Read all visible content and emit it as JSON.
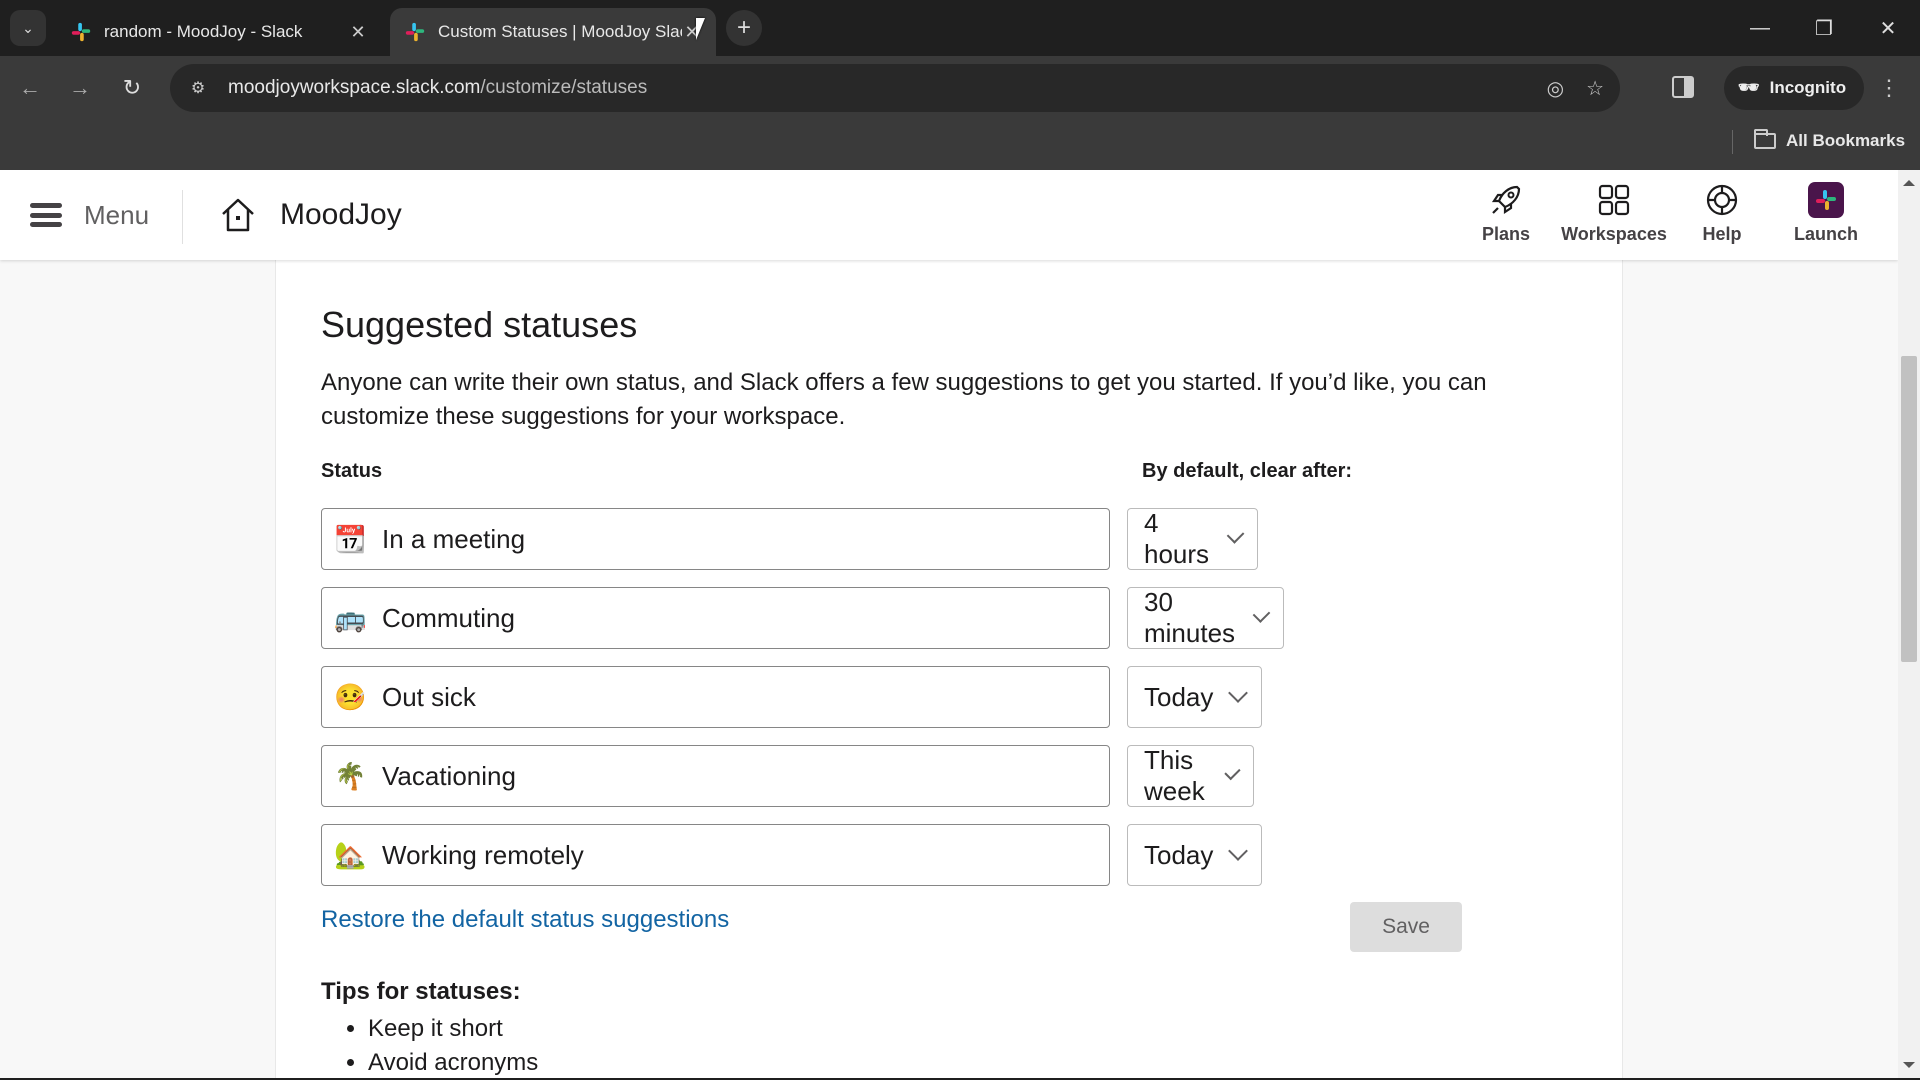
{
  "browser": {
    "tabs": [
      {
        "title": "random - MoodJoy - Slack",
        "active": false,
        "close_glyph": "✕"
      },
      {
        "title": "Custom Statuses | MoodJoy Slack",
        "active": true,
        "close_glyph": "✕"
      }
    ],
    "tab_search_glyph": "⌄",
    "new_tab_glyph": "+",
    "window_controls": {
      "minimize": "—",
      "restore": "❐",
      "close": "✕"
    },
    "nav": {
      "back": "←",
      "forward": "→",
      "reload": "↻"
    },
    "url_host": "moodjoyworkspace.slack.com",
    "url_path": "/customize/statuses",
    "site_info_glyph": "⚙",
    "tracking_glyph": "◎",
    "bookmark_star_glyph": "☆",
    "profile_label": "Incognito",
    "incognito_glyph": "🕶",
    "menu_glyph": "⋮",
    "bookmarks_label": "All Bookmarks"
  },
  "header": {
    "menu_label": "Menu",
    "workspace_name": "MoodJoy",
    "nav_items": [
      {
        "label": "Plans",
        "icon": "rocket-icon"
      },
      {
        "label": "Workspaces",
        "icon": "grid-icon"
      },
      {
        "label": "Help",
        "icon": "lifebuoy-icon"
      },
      {
        "label": "Launch",
        "icon": "slack-logo-icon"
      }
    ]
  },
  "main": {
    "title": "Suggested statuses",
    "description": "Anyone can write their own status, and Slack offers a few suggestions to get you started. If you’d like, you can customize these suggestions for your workspace.",
    "status_column_label": "Status",
    "clear_column_label": "By default, clear after:",
    "statuses": [
      {
        "emoji": "📆",
        "emoji_name": "calendar-icon",
        "text": "In a meeting",
        "clear_after": "4 hours"
      },
      {
        "emoji": "🚌",
        "emoji_name": "bus-icon",
        "text": "Commuting",
        "clear_after": "30 minutes"
      },
      {
        "emoji": "🤒",
        "emoji_name": "sick-face-icon",
        "text": "Out sick",
        "clear_after": "Today"
      },
      {
        "emoji": "🌴",
        "emoji_name": "palm-tree-icon",
        "text": "Vacationing",
        "clear_after": "This week"
      },
      {
        "emoji": "🏡",
        "emoji_name": "house-icon",
        "text": "Working remotely",
        "clear_after": "Today"
      }
    ],
    "restore_link": "Restore the default status suggestions",
    "save_label": "Save",
    "tips_title": "Tips for statuses:",
    "tips": [
      "Keep it short",
      "Avoid acronyms"
    ]
  },
  "colors": {
    "link": "#1264a3",
    "launch_tile": "#4a154b",
    "save_bg": "#dddddd"
  }
}
